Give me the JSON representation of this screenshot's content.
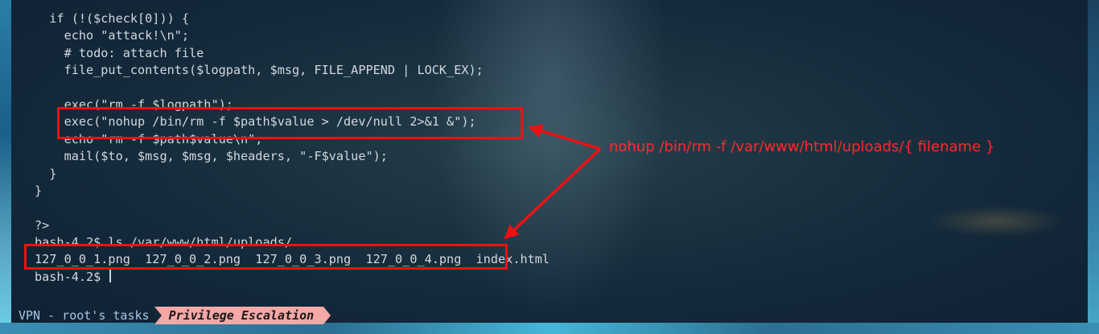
{
  "terminal": {
    "lines": [
      "  if (!($check[0])) {",
      "    echo \"attack!\\n\";",
      "    # todo: attach file",
      "    file_put_contents($logpath, $msg, FILE_APPEND | LOCK_EX);",
      "",
      "    exec(\"rm -f $logpath\");",
      "    exec(\"nohup /bin/rm -f $path$value > /dev/null 2>&1 &\");",
      "    echo \"rm -f $path$value\\n\";",
      "    mail($to, $msg, $msg, $headers, \"-F$value\");",
      "  }",
      "}",
      "",
      "?>",
      "bash-4.2$ ls /var/www/html/uploads/",
      "127_0_0_1.png  127_0_0_2.png  127_0_0_3.png  127_0_0_4.png  index.html",
      "bash-4.2$ "
    ]
  },
  "annotation": {
    "text": "nohup /bin/rm -f /var/www/html/uploads/{ filename }",
    "color": "#ee1111"
  },
  "statusbar": {
    "left_label": "VPN - root's tasks",
    "active_tab": "Privilege Escalation",
    "tab_color": "#f5a8a6"
  }
}
